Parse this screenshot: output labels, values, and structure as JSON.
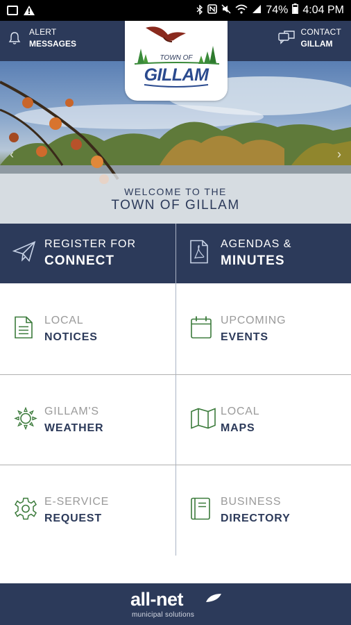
{
  "status_bar": {
    "battery": "74%",
    "time": "4:04 PM",
    "icons": [
      "image-icon",
      "warning-icon",
      "bluetooth-icon",
      "nfc-icon",
      "mute-icon",
      "wifi-icon",
      "signal-icon",
      "battery-icon"
    ]
  },
  "header": {
    "alert": {
      "line1": "ALERT",
      "line2": "MESSAGES",
      "icon": "bell-icon"
    },
    "contact": {
      "line1": "CONTACT",
      "line2": "GILLAM",
      "icon": "chat-icon"
    }
  },
  "logo": {
    "town_of": "TOWN OF",
    "gillam": "GILLAM"
  },
  "banner": {
    "welcome_line1": "WELCOME TO THE",
    "welcome_line2": "TOWN OF GILLAM"
  },
  "tiles": [
    {
      "line1": "REGISTER FOR",
      "line2": "CONNECT",
      "icon": "paper-plane-icon"
    },
    {
      "line1": "AGENDAS &",
      "line2": "MINUTES",
      "icon": "pdf-file-icon"
    },
    {
      "line1": "LOCAL",
      "line2": "NOTICES",
      "icon": "document-icon"
    },
    {
      "line1": "UPCOMING",
      "line2": "EVENTS",
      "icon": "calendar-icon"
    },
    {
      "line1": "GILLAM'S",
      "line2": "WEATHER",
      "icon": "sun-icon"
    },
    {
      "line1": "LOCAL",
      "line2": "MAPS",
      "icon": "map-icon"
    },
    {
      "line1": "E-SERVICE",
      "line2": "REQUEST",
      "icon": "gear-icon"
    },
    {
      "line1": "BUSINESS",
      "line2": "DIRECTORY",
      "icon": "book-icon"
    }
  ],
  "footer": {
    "brand": "all-net",
    "sub": "municipal solutions"
  },
  "colors": {
    "navy": "#2c3a5a",
    "green_icon": "#3a7a3a",
    "divider": "#b0b0b0"
  }
}
